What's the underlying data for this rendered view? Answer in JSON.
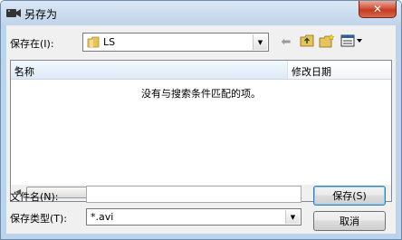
{
  "window": {
    "title": "另存为",
    "close_glyph": "✕"
  },
  "save_in": {
    "label": "保存在(I):",
    "folder": "LS"
  },
  "file_list": {
    "columns": [
      "名称",
      "修改日期"
    ],
    "empty_message": "没有与搜索条件匹配的项。"
  },
  "scrollbar": {
    "left_arrow": "◀",
    "right_arrow": "▶",
    "grip": "|||"
  },
  "file_name": {
    "label": "文件名(N):",
    "value": ""
  },
  "save_type": {
    "label": "保存类型(T):",
    "value": "*.avi"
  },
  "buttons": {
    "save": "保存(S)",
    "cancel": "取消"
  },
  "icons": {
    "app": "video-camera-icon",
    "folder": "folder-icon",
    "back": "back-arrow-icon",
    "up": "up-folder-icon",
    "new_folder": "new-folder-icon",
    "view": "view-menu-icon"
  },
  "colors": {
    "close_button": "#c23b22",
    "frame": "#bcd3ec",
    "header_highlight": "#dbeaf7"
  }
}
